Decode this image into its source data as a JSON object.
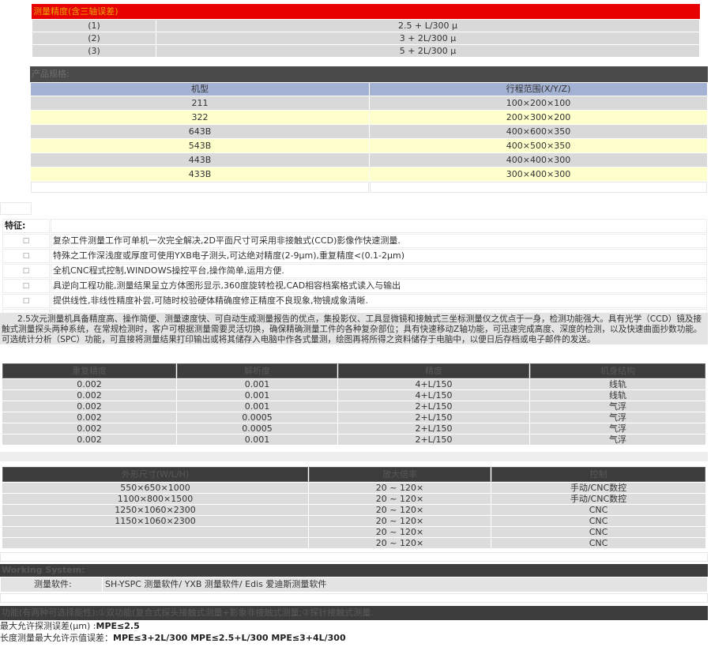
{
  "accuracy": {
    "header": "测量精度(含三轴误差)",
    "rows": [
      {
        "label": "(1)",
        "value": "2.5 + L/300 μ"
      },
      {
        "label": "(2)",
        "value": "3 + 2L/300 μ"
      },
      {
        "label": "(3)",
        "value": "5 + 2L/300 μ"
      }
    ]
  },
  "specs": {
    "header": "产品规格:",
    "columns": [
      "机型",
      "行程范围(X/Y/Z)"
    ],
    "rows": [
      [
        "211",
        "100×200×100"
      ],
      [
        "322",
        "200×300×200"
      ],
      [
        "643B",
        "400×600×350"
      ],
      [
        "543B",
        "400×500×350"
      ],
      [
        "443B",
        "400×400×300"
      ],
      [
        "433B",
        "300×400×300"
      ]
    ]
  },
  "features": {
    "title": "特征:",
    "bullet": "□",
    "items": [
      "复杂工件测量工作可单机一次完全解决,2D平面尺寸可采用非接触式(CCD)影像作快速测量.",
      "特殊之工作深浅度或厚度可使用YXB电子测头,可达绝对精度(2-9μm),重复精度<(0.1-2μm)",
      "全机CNC程式控制,WINDOWS操控平台,操作简单,运用方便.",
      "具逆向工程功能,测量结果呈立方体图形显示,360度旋转检视,CAD相容档案格式读入与输出",
      "提供线性,非线性精度补尝,可随时校验硬体精确度修正精度不良现象,物镜成象清晰."
    ]
  },
  "description": "2.5次元测量机具备精度高、操作简便、测量速度快、可自动生成测量报告的优点，集投影仪、工具显微镜和接触式三坐标测量仪之优点于一身，检测功能强大。具有光学（CCD）镜及接触式测量探头两种系统，在常规检测时，客户可根据测量需要灵活切换，确保精确测量工件的各种复杂部位；具有快速移动Z轴功能，可迅速完成高度、深度的检测，以及快速曲面抄数功能。可选统计分析（SPC）功能，可直接将测量结果打印输出或将其储存入电脑中作各式量测，绘图再将所得之资料储存于电脑中，以便日后存档或电子邮件的发送。",
  "performance": {
    "columns": [
      "重复精度",
      "解析度",
      "精度",
      "机身结构"
    ],
    "rows": [
      [
        "0.002",
        "0.001",
        "4+L/150",
        "线轨"
      ],
      [
        "0.002",
        "0.001",
        "4+L/150",
        "线轨"
      ],
      [
        "0.002",
        "0.001",
        "2+L/150",
        "气浮"
      ],
      [
        "0.002",
        "0.0005",
        "2+L/150",
        "气浮"
      ],
      [
        "0.002",
        "0.0005",
        "2+L/150",
        "气浮"
      ],
      [
        "0.002",
        "0.001",
        "2+L/150",
        "气浮"
      ]
    ]
  },
  "dimensions": {
    "columns": [
      "外形尺寸(W/L/H)",
      "放大倍率",
      "控制"
    ],
    "rows": [
      [
        "550×650×1000",
        "20 ~ 120×",
        "手动/CNC数控"
      ],
      [
        "1100×800×1500",
        "20 ~ 120×",
        "手动/CNC数控"
      ],
      [
        "1250×1060×2300",
        "20 ~ 120×",
        "CNC"
      ],
      [
        "1150×1060×2300",
        "20 ~ 120×",
        "CNC"
      ],
      [
        "",
        "20 ~ 120×",
        "CNC"
      ],
      [
        "",
        "20 ~ 120×",
        "CNC"
      ]
    ]
  },
  "working_system": {
    "header": "Working System:",
    "label": "测量软件:",
    "value": "SH-YSPC 测量软件/ YXB 测量软件/ Edis 爱迪斯测量软件"
  },
  "functions": {
    "header": "功能(有两种可选择能性):①双功能(复合式探头接触式测量+影象非接触式测量;②探针接触式测量.",
    "line1_label": "最大允许探测误差(μm) :",
    "line1_value": "MPE≤2.5",
    "line2_label": "长度测量最大允许示值误差：",
    "line2_value": "MPE≤3+2L/300  MPE≤2.5+L/300  MPE≤3+4L/300"
  }
}
